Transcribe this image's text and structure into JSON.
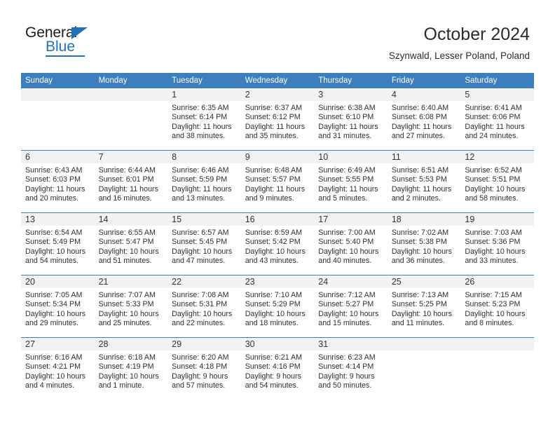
{
  "brand": {
    "name_part1": "General",
    "name_part2": "Blue",
    "triangle_icon": "triangle-icon",
    "accent_color": "#1f72b8"
  },
  "header": {
    "title": "October 2024",
    "subtitle": "Szynwald, Lesser Poland, Poland"
  },
  "theme": {
    "header_row_bg": "#3d7ebd",
    "daynum_bg": "#f2f2f2",
    "grid_line": "#3d7ebd",
    "text": "#2e2e2e"
  },
  "columns": [
    "Sunday",
    "Monday",
    "Tuesday",
    "Wednesday",
    "Thursday",
    "Friday",
    "Saturday"
  ],
  "weeks": [
    [
      {
        "day": "",
        "sunrise": "",
        "sunset": "",
        "daylight_line1": "",
        "daylight_line2": ""
      },
      {
        "day": "",
        "sunrise": "",
        "sunset": "",
        "daylight_line1": "",
        "daylight_line2": ""
      },
      {
        "day": "1",
        "sunrise": "Sunrise: 6:35 AM",
        "sunset": "Sunset: 6:14 PM",
        "daylight_line1": "Daylight: 11 hours",
        "daylight_line2": "and 38 minutes."
      },
      {
        "day": "2",
        "sunrise": "Sunrise: 6:37 AM",
        "sunset": "Sunset: 6:12 PM",
        "daylight_line1": "Daylight: 11 hours",
        "daylight_line2": "and 35 minutes."
      },
      {
        "day": "3",
        "sunrise": "Sunrise: 6:38 AM",
        "sunset": "Sunset: 6:10 PM",
        "daylight_line1": "Daylight: 11 hours",
        "daylight_line2": "and 31 minutes."
      },
      {
        "day": "4",
        "sunrise": "Sunrise: 6:40 AM",
        "sunset": "Sunset: 6:08 PM",
        "daylight_line1": "Daylight: 11 hours",
        "daylight_line2": "and 27 minutes."
      },
      {
        "day": "5",
        "sunrise": "Sunrise: 6:41 AM",
        "sunset": "Sunset: 6:06 PM",
        "daylight_line1": "Daylight: 11 hours",
        "daylight_line2": "and 24 minutes."
      }
    ],
    [
      {
        "day": "6",
        "sunrise": "Sunrise: 6:43 AM",
        "sunset": "Sunset: 6:03 PM",
        "daylight_line1": "Daylight: 11 hours",
        "daylight_line2": "and 20 minutes."
      },
      {
        "day": "7",
        "sunrise": "Sunrise: 6:44 AM",
        "sunset": "Sunset: 6:01 PM",
        "daylight_line1": "Daylight: 11 hours",
        "daylight_line2": "and 16 minutes."
      },
      {
        "day": "8",
        "sunrise": "Sunrise: 6:46 AM",
        "sunset": "Sunset: 5:59 PM",
        "daylight_line1": "Daylight: 11 hours",
        "daylight_line2": "and 13 minutes."
      },
      {
        "day": "9",
        "sunrise": "Sunrise: 6:48 AM",
        "sunset": "Sunset: 5:57 PM",
        "daylight_line1": "Daylight: 11 hours",
        "daylight_line2": "and 9 minutes."
      },
      {
        "day": "10",
        "sunrise": "Sunrise: 6:49 AM",
        "sunset": "Sunset: 5:55 PM",
        "daylight_line1": "Daylight: 11 hours",
        "daylight_line2": "and 5 minutes."
      },
      {
        "day": "11",
        "sunrise": "Sunrise: 6:51 AM",
        "sunset": "Sunset: 5:53 PM",
        "daylight_line1": "Daylight: 11 hours",
        "daylight_line2": "and 2 minutes."
      },
      {
        "day": "12",
        "sunrise": "Sunrise: 6:52 AM",
        "sunset": "Sunset: 5:51 PM",
        "daylight_line1": "Daylight: 10 hours",
        "daylight_line2": "and 58 minutes."
      }
    ],
    [
      {
        "day": "13",
        "sunrise": "Sunrise: 6:54 AM",
        "sunset": "Sunset: 5:49 PM",
        "daylight_line1": "Daylight: 10 hours",
        "daylight_line2": "and 54 minutes."
      },
      {
        "day": "14",
        "sunrise": "Sunrise: 6:55 AM",
        "sunset": "Sunset: 5:47 PM",
        "daylight_line1": "Daylight: 10 hours",
        "daylight_line2": "and 51 minutes."
      },
      {
        "day": "15",
        "sunrise": "Sunrise: 6:57 AM",
        "sunset": "Sunset: 5:45 PM",
        "daylight_line1": "Daylight: 10 hours",
        "daylight_line2": "and 47 minutes."
      },
      {
        "day": "16",
        "sunrise": "Sunrise: 6:59 AM",
        "sunset": "Sunset: 5:42 PM",
        "daylight_line1": "Daylight: 10 hours",
        "daylight_line2": "and 43 minutes."
      },
      {
        "day": "17",
        "sunrise": "Sunrise: 7:00 AM",
        "sunset": "Sunset: 5:40 PM",
        "daylight_line1": "Daylight: 10 hours",
        "daylight_line2": "and 40 minutes."
      },
      {
        "day": "18",
        "sunrise": "Sunrise: 7:02 AM",
        "sunset": "Sunset: 5:38 PM",
        "daylight_line1": "Daylight: 10 hours",
        "daylight_line2": "and 36 minutes."
      },
      {
        "day": "19",
        "sunrise": "Sunrise: 7:03 AM",
        "sunset": "Sunset: 5:36 PM",
        "daylight_line1": "Daylight: 10 hours",
        "daylight_line2": "and 33 minutes."
      }
    ],
    [
      {
        "day": "20",
        "sunrise": "Sunrise: 7:05 AM",
        "sunset": "Sunset: 5:34 PM",
        "daylight_line1": "Daylight: 10 hours",
        "daylight_line2": "and 29 minutes."
      },
      {
        "day": "21",
        "sunrise": "Sunrise: 7:07 AM",
        "sunset": "Sunset: 5:33 PM",
        "daylight_line1": "Daylight: 10 hours",
        "daylight_line2": "and 25 minutes."
      },
      {
        "day": "22",
        "sunrise": "Sunrise: 7:08 AM",
        "sunset": "Sunset: 5:31 PM",
        "daylight_line1": "Daylight: 10 hours",
        "daylight_line2": "and 22 minutes."
      },
      {
        "day": "23",
        "sunrise": "Sunrise: 7:10 AM",
        "sunset": "Sunset: 5:29 PM",
        "daylight_line1": "Daylight: 10 hours",
        "daylight_line2": "and 18 minutes."
      },
      {
        "day": "24",
        "sunrise": "Sunrise: 7:12 AM",
        "sunset": "Sunset: 5:27 PM",
        "daylight_line1": "Daylight: 10 hours",
        "daylight_line2": "and 15 minutes."
      },
      {
        "day": "25",
        "sunrise": "Sunrise: 7:13 AM",
        "sunset": "Sunset: 5:25 PM",
        "daylight_line1": "Daylight: 10 hours",
        "daylight_line2": "and 11 minutes."
      },
      {
        "day": "26",
        "sunrise": "Sunrise: 7:15 AM",
        "sunset": "Sunset: 5:23 PM",
        "daylight_line1": "Daylight: 10 hours",
        "daylight_line2": "and 8 minutes."
      }
    ],
    [
      {
        "day": "27",
        "sunrise": "Sunrise: 6:16 AM",
        "sunset": "Sunset: 4:21 PM",
        "daylight_line1": "Daylight: 10 hours",
        "daylight_line2": "and 4 minutes."
      },
      {
        "day": "28",
        "sunrise": "Sunrise: 6:18 AM",
        "sunset": "Sunset: 4:19 PM",
        "daylight_line1": "Daylight: 10 hours",
        "daylight_line2": "and 1 minute."
      },
      {
        "day": "29",
        "sunrise": "Sunrise: 6:20 AM",
        "sunset": "Sunset: 4:18 PM",
        "daylight_line1": "Daylight: 9 hours",
        "daylight_line2": "and 57 minutes."
      },
      {
        "day": "30",
        "sunrise": "Sunrise: 6:21 AM",
        "sunset": "Sunset: 4:16 PM",
        "daylight_line1": "Daylight: 9 hours",
        "daylight_line2": "and 54 minutes."
      },
      {
        "day": "31",
        "sunrise": "Sunrise: 6:23 AM",
        "sunset": "Sunset: 4:14 PM",
        "daylight_line1": "Daylight: 9 hours",
        "daylight_line2": "and 50 minutes."
      },
      {
        "day": "",
        "sunrise": "",
        "sunset": "",
        "daylight_line1": "",
        "daylight_line2": ""
      },
      {
        "day": "",
        "sunrise": "",
        "sunset": "",
        "daylight_line1": "",
        "daylight_line2": ""
      }
    ]
  ]
}
